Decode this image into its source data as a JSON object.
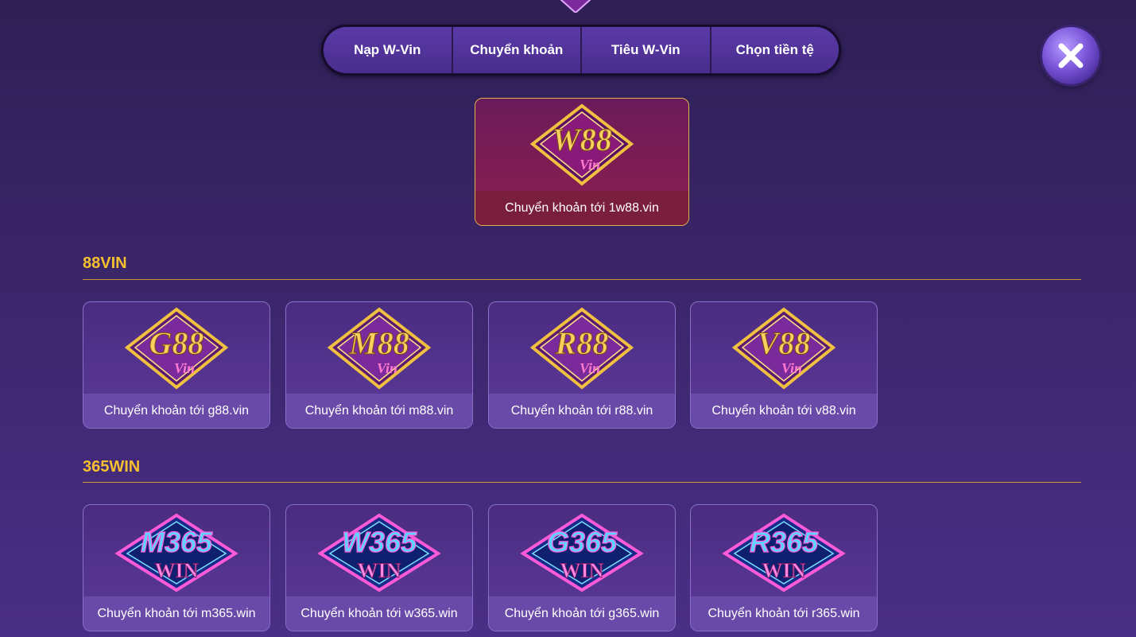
{
  "tabs": [
    "Nạp W-Vin",
    "Chuyển khoản",
    "Tiêu W-Vin",
    "Chọn tiền tệ"
  ],
  "featured": {
    "logo_main": "W88",
    "logo_sub": "Vin",
    "caption": "Chuyển khoản tới 1w88.vin"
  },
  "sections": [
    {
      "title": "88VIN",
      "cards": [
        {
          "logo_main": "G88",
          "logo_sub": "Vin",
          "caption": "Chuyển khoản tới g88.vin"
        },
        {
          "logo_main": "M88",
          "logo_sub": "Vin",
          "caption": "Chuyển khoản tới m88.vin"
        },
        {
          "logo_main": "R88",
          "logo_sub": "Vin",
          "caption": "Chuyển khoản tới r88.vin"
        },
        {
          "logo_main": "V88",
          "logo_sub": "Vin",
          "caption": "Chuyển khoản tới v88.vin"
        }
      ]
    },
    {
      "title": "365WIN",
      "cards": [
        {
          "logo_main": "M365",
          "logo_sub": "WIN",
          "caption": "Chuyển khoản tới m365.win"
        },
        {
          "logo_main": "W365",
          "logo_sub": "WIN",
          "caption": "Chuyển khoản tới w365.win"
        },
        {
          "logo_main": "G365",
          "logo_sub": "WIN",
          "caption": "Chuyển khoản tới g365.win"
        },
        {
          "logo_main": "R365",
          "logo_sub": "WIN",
          "caption": "Chuyển khoản tới r365.win"
        }
      ]
    }
  ],
  "colors": {
    "gold": "#f5c030",
    "pink": "#ff5ad8",
    "cyan": "#5fd3ff"
  }
}
